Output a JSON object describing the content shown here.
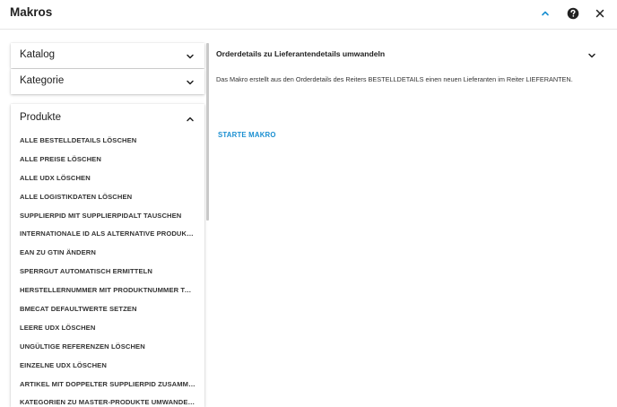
{
  "dialog": {
    "title": "Makros",
    "icons": {
      "collapse": "chevron-up-icon",
      "help": "help-circle-icon",
      "close": "close-icon"
    },
    "accent_color": "#1a8fd1"
  },
  "sidebar": {
    "sections": [
      {
        "label": "Katalog",
        "expanded": false
      },
      {
        "label": "Kategorie",
        "expanded": false
      },
      {
        "label": "Produkte",
        "expanded": true
      }
    ],
    "produkte_items": [
      "ALLE BESTELLDETAILS LÖSCHEN",
      "ALLE PREISE LÖSCHEN",
      "ALLE UDX LÖSCHEN",
      "ALLE LOGISTIKDATEN LÖSCHEN",
      "SUPPLIERPID MIT SUPPLIERPIDALT TAUSCHEN",
      "INTERNATIONALE ID ALS ALTERNATIVE PRODUKTNUMMER",
      "EAN ZU GTIN ÄNDERN",
      "SPERRGUT AUTOMATISCH ERMITTELN",
      "HERSTELLERNUMMER MIT PRODUKTNUMMER TAUSCHEN",
      "BMECAT DEFAULTWERTE SETZEN",
      "LEERE UDX LÖSCHEN",
      "UNGÜLTIGE REFERENZEN LÖSCHEN",
      "EINZELNE UDX LÖSCHEN",
      "ARTIKEL MIT DOPPELTER SUPPLIERPID ZUSAMMENFÜHREN",
      "KATEGORIEN ZU MASTER-PRODUKTE UMWANDELN"
    ]
  },
  "detail": {
    "title": "Orderdetails zu Lieferantendetails umwandeln",
    "description": "Das Makro erstellt aus den Orderdetails des Reiters BESTELLDETAILS einen neuen Lieferanten im Reiter LIEFERANTEN.",
    "start_label": "STARTE MAKRO"
  }
}
